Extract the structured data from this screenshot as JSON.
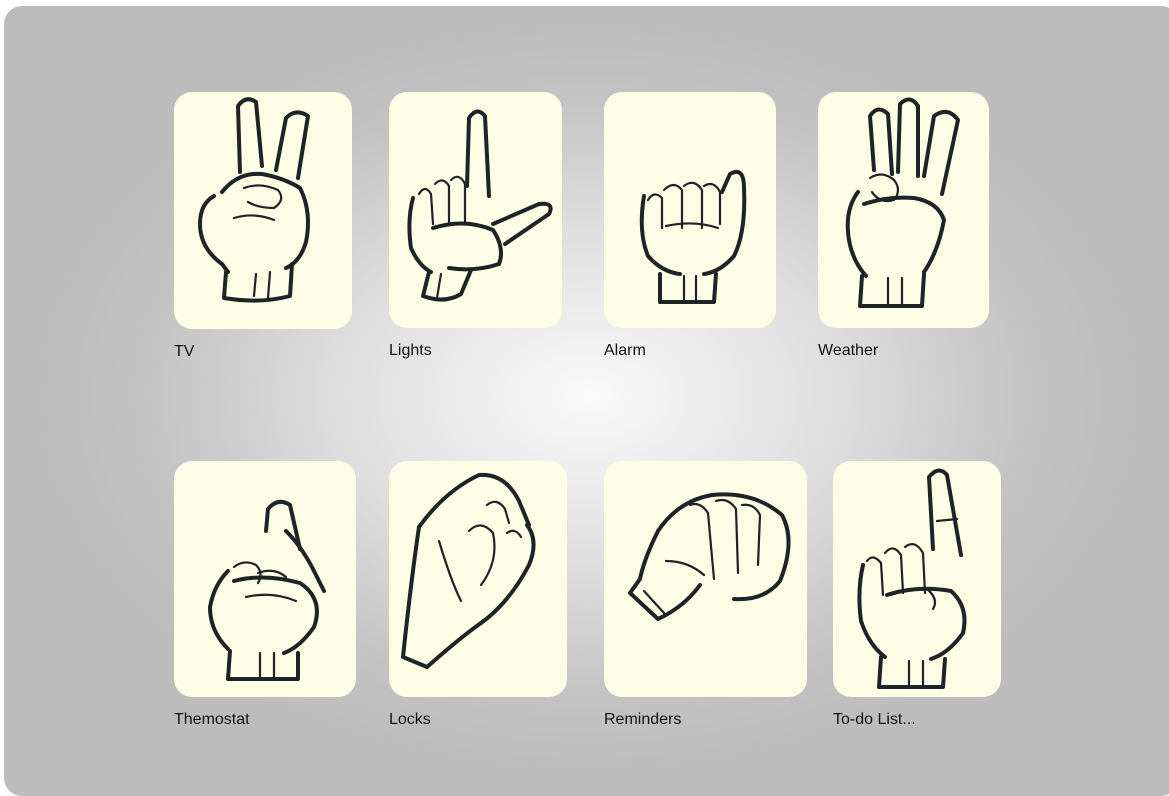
{
  "tiles": [
    {
      "label": "TV",
      "icon": "hand-sign-v-icon"
    },
    {
      "label": "Lights",
      "icon": "hand-sign-l-icon"
    },
    {
      "label": "Alarm",
      "icon": "hand-sign-a-icon"
    },
    {
      "label": "Weather",
      "icon": "hand-sign-w-icon"
    },
    {
      "label": "Themostat",
      "icon": "hand-sign-r-icon"
    },
    {
      "label": "Locks",
      "icon": "hand-sign-c-icon"
    },
    {
      "label": "Reminders",
      "icon": "hand-sign-s-icon"
    },
    {
      "label": "To-do List...",
      "icon": "hand-sign-i-icon"
    }
  ],
  "colors": {
    "card": "#fdfde6",
    "ink": "#1d2326",
    "label": "#111111"
  }
}
